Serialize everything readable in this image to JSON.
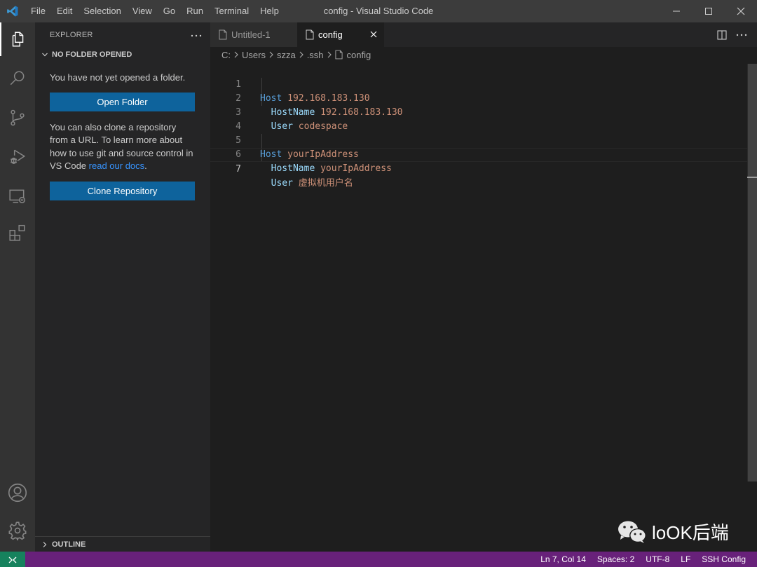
{
  "titlebar": {
    "app_icon": "vscode-logo-icon",
    "menu": [
      "File",
      "Edit",
      "Selection",
      "View",
      "Go",
      "Run",
      "Terminal",
      "Help"
    ],
    "window_title": "config - Visual Studio Code",
    "controls": [
      "minimize-icon",
      "maximize-icon",
      "close-icon"
    ]
  },
  "activitybar": {
    "items": [
      "explorer-icon",
      "search-icon",
      "source-control-icon",
      "run-debug-icon",
      "remote-explorer-icon",
      "extensions-icon"
    ],
    "bottom": [
      "accounts-icon",
      "settings-gear-icon"
    ],
    "active": "explorer-icon"
  },
  "sidebar": {
    "title": "EXPLORER",
    "more_icon": "ellipsis-icon",
    "section": "NO FOLDER OPENED",
    "no_folder_text": "You have not yet opened a folder.",
    "open_folder_label": "Open Folder",
    "clone_text_prefix": "You can also clone a repository from a URL. To learn more about how to use git and source control in VS Code ",
    "clone_link": "read our docs",
    "clone_text_suffix": ".",
    "clone_label": "Clone Repository",
    "outline_label": "OUTLINE"
  },
  "editor": {
    "tabs": [
      {
        "label": "Untitled-1",
        "active": false
      },
      {
        "label": "config",
        "active": true
      }
    ],
    "breadcrumb": [
      "C:",
      "Users",
      "szza",
      ".ssh",
      "config"
    ],
    "lines": [
      {
        "n": "1",
        "indent": "",
        "key": "Host",
        "value": "192.168.183.130"
      },
      {
        "n": "2",
        "indent": "  ",
        "key": "HostName",
        "value": "192.168.183.130"
      },
      {
        "n": "3",
        "indent": "  ",
        "key": "User",
        "value": "codespace"
      },
      {
        "n": "4",
        "indent": "",
        "key": "",
        "value": ""
      },
      {
        "n": "5",
        "indent": "",
        "key": "Host",
        "value": "yourIpAddress"
      },
      {
        "n": "6",
        "indent": "  ",
        "key": "HostName",
        "value": "yourIpAddress"
      },
      {
        "n": "7",
        "indent": "  ",
        "key": "User",
        "value": "虚拟机用户名"
      }
    ],
    "current_line": "7"
  },
  "statusbar": {
    "remote_icon": "remote-indicator-icon",
    "position": "Ln 7, Col 14",
    "spaces": "Spaces: 2",
    "encoding": "UTF-8",
    "eol": "LF",
    "language": "SSH Config"
  },
  "watermark": {
    "icon": "wechat-icon",
    "text": "loOK后端"
  },
  "colors": {
    "statusbar": "#68217a",
    "remote": "#16825d",
    "button": "#0e639c",
    "link": "#3794ff"
  }
}
